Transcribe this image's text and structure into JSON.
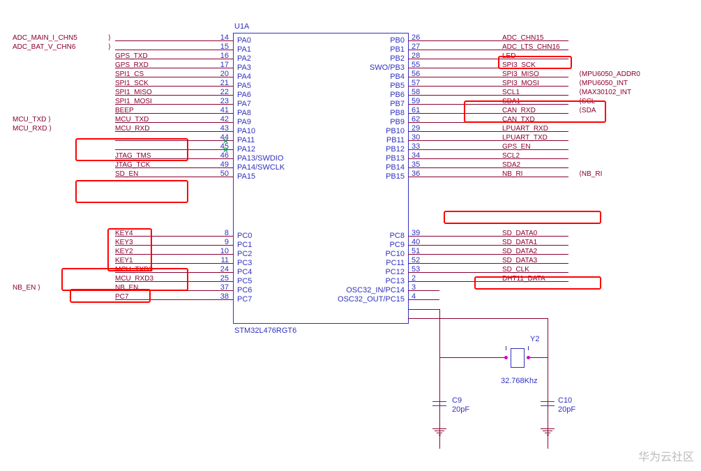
{
  "component": {
    "refdes": "U1A",
    "part": "STM32L476RGT6"
  },
  "left_pins": [
    {
      "num": "14",
      "name": "PA0",
      "net": "ADC_MAIN_I_CHN5",
      "bus": true
    },
    {
      "num": "15",
      "name": "PA1",
      "net": "ADC_BAT_V_CHN6",
      "bus": true
    },
    {
      "num": "16",
      "name": "PA2",
      "net": "GPS_TXD"
    },
    {
      "num": "17",
      "name": "PA3",
      "net": "GPS_RXD"
    },
    {
      "num": "20",
      "name": "PA4",
      "net": "SPI1_CS"
    },
    {
      "num": "21",
      "name": "PA5",
      "net": "SPI1_SCK"
    },
    {
      "num": "22",
      "name": "PA6",
      "net": "SPI1_MISO"
    },
    {
      "num": "23",
      "name": "PA7",
      "net": "SPI1_MOSI"
    },
    {
      "num": "41",
      "name": "PA8",
      "net": "BEEP"
    },
    {
      "num": "42",
      "name": "PA9",
      "net": "MCU_TXD",
      "bus": "MCU_TXD"
    },
    {
      "num": "43",
      "name": "PA10",
      "net": "MCU_RXD",
      "bus": "MCU_RXD"
    },
    {
      "num": "44",
      "name": "PA11",
      "nc": true
    },
    {
      "num": "45",
      "name": "PA12",
      "nc": true
    },
    {
      "num": "46",
      "name": "PA13/SWDIO",
      "net": "JTAG_TMS"
    },
    {
      "num": "49",
      "name": "PA14/SWCLK",
      "net": "JTAG_TCK"
    },
    {
      "num": "50",
      "name": "PA15",
      "net": "SD_EN"
    },
    {
      "num": "8",
      "name": "PC0",
      "net": "KEY4"
    },
    {
      "num": "9",
      "name": "PC1",
      "net": "KEY3"
    },
    {
      "num": "10",
      "name": "PC2",
      "net": "KEY2"
    },
    {
      "num": "11",
      "name": "PC3",
      "net": "KEY1"
    },
    {
      "num": "24",
      "name": "PC4",
      "net": "MCU_TXD3"
    },
    {
      "num": "25",
      "name": "PC5",
      "net": "MCU_RXD3"
    },
    {
      "num": "37",
      "name": "PC6",
      "net": "NB_EN",
      "bus": "NB_EN"
    },
    {
      "num": "38",
      "name": "PC7",
      "net": "PC7"
    }
  ],
  "right_pins": [
    {
      "num": "26",
      "name": "PB0",
      "net": "ADC_CHN15"
    },
    {
      "num": "27",
      "name": "PB1",
      "net": "ADC_LTS_CHN16"
    },
    {
      "num": "28",
      "name": "PB2",
      "net": "LED"
    },
    {
      "num": "55",
      "name": "SWO/PB3",
      "net": "SPI3_SCK"
    },
    {
      "num": "56",
      "name": "PB4",
      "net": "SPI3_MISO",
      "bus": "MPU6050_ADDR0"
    },
    {
      "num": "57",
      "name": "PB5",
      "net": "SPI3_MOSI",
      "bus": "MPU6050_INT"
    },
    {
      "num": "58",
      "name": "PB6",
      "net": "SCL1",
      "bus": "MAX30102_INT"
    },
    {
      "num": "59",
      "name": "PB7",
      "net": "SDA1",
      "bus": "SCL"
    },
    {
      "num": "61",
      "name": "PB8",
      "net": "CAN_RXD",
      "bus": "SDA"
    },
    {
      "num": "62",
      "name": "PB9",
      "net": "CAN_TXD"
    },
    {
      "num": "29",
      "name": "PB10",
      "net": "LPUART_RXD"
    },
    {
      "num": "30",
      "name": "PB11",
      "net": "LPUART_TXD"
    },
    {
      "num": "33",
      "name": "PB12",
      "net": "GPS_EN"
    },
    {
      "num": "34",
      "name": "PB13",
      "net": "SCL2"
    },
    {
      "num": "35",
      "name": "PB14",
      "net": "SDA2"
    },
    {
      "num": "36",
      "name": "PB15",
      "net": "NB_RI",
      "bus": "NB_RI"
    },
    {
      "num": "39",
      "name": "PC8",
      "net": "SD_DATA0"
    },
    {
      "num": "40",
      "name": "PC9",
      "net": "SD_DATA1"
    },
    {
      "num": "51",
      "name": "PC10",
      "net": "SD_DATA2"
    },
    {
      "num": "52",
      "name": "PC11",
      "net": "SD_DATA3"
    },
    {
      "num": "53",
      "name": "PC12",
      "net": "SD_CLK"
    },
    {
      "num": "2",
      "name": "PC13",
      "net": "DHT11_DATA"
    },
    {
      "num": "3",
      "name": "OSC32_IN/PC14"
    },
    {
      "num": "4",
      "name": "OSC32_OUT/PC15"
    }
  ],
  "crystal": {
    "ref": "Y2",
    "value": "32.768Khz"
  },
  "caps": [
    {
      "ref": "C9",
      "value": "20pF"
    },
    {
      "ref": "C10",
      "value": "20pF"
    }
  ],
  "watermark": "华为云社区"
}
